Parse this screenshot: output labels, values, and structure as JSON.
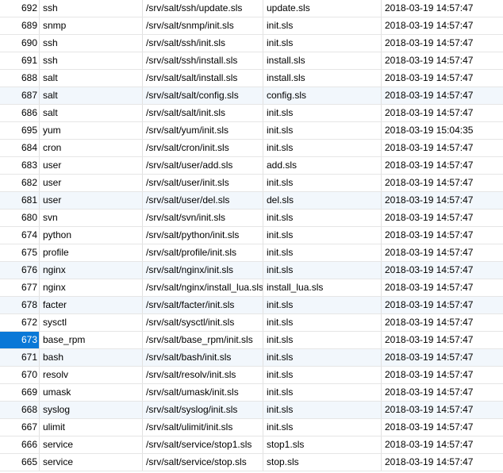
{
  "table": {
    "selected_id": "673",
    "rows": [
      {
        "id": "692",
        "name": "ssh",
        "path": "/srv/salt/ssh/update.sls",
        "file": "update.sls",
        "time": "2018-03-19 14:57:47"
      },
      {
        "id": "689",
        "name": "snmp",
        "path": "/srv/salt/snmp/init.sls",
        "file": "init.sls",
        "time": "2018-03-19 14:57:47"
      },
      {
        "id": "690",
        "name": "ssh",
        "path": "/srv/salt/ssh/init.sls",
        "file": "init.sls",
        "time": "2018-03-19 14:57:47"
      },
      {
        "id": "691",
        "name": "ssh",
        "path": "/srv/salt/ssh/install.sls",
        "file": "install.sls",
        "time": "2018-03-19 14:57:47"
      },
      {
        "id": "688",
        "name": "salt",
        "path": "/srv/salt/salt/install.sls",
        "file": "install.sls",
        "time": "2018-03-19 14:57:47"
      },
      {
        "id": "687",
        "name": "salt",
        "path": "/srv/salt/salt/config.sls",
        "file": "config.sls",
        "time": "2018-03-19 14:57:47"
      },
      {
        "id": "686",
        "name": "salt",
        "path": "/srv/salt/salt/init.sls",
        "file": "init.sls",
        "time": "2018-03-19 14:57:47"
      },
      {
        "id": "695",
        "name": "yum",
        "path": "/srv/salt/yum/init.sls",
        "file": "init.sls",
        "time": "2018-03-19 15:04:35"
      },
      {
        "id": "684",
        "name": "cron",
        "path": "/srv/salt/cron/init.sls",
        "file": "init.sls",
        "time": "2018-03-19 14:57:47"
      },
      {
        "id": "683",
        "name": "user",
        "path": "/srv/salt/user/add.sls",
        "file": "add.sls",
        "time": "2018-03-19 14:57:47"
      },
      {
        "id": "682",
        "name": "user",
        "path": "/srv/salt/user/init.sls",
        "file": "init.sls",
        "time": "2018-03-19 14:57:47"
      },
      {
        "id": "681",
        "name": "user",
        "path": "/srv/salt/user/del.sls",
        "file": "del.sls",
        "time": "2018-03-19 14:57:47"
      },
      {
        "id": "680",
        "name": "svn",
        "path": "/srv/salt/svn/init.sls",
        "file": "init.sls",
        "time": "2018-03-19 14:57:47"
      },
      {
        "id": "674",
        "name": "python",
        "path": "/srv/salt/python/init.sls",
        "file": "init.sls",
        "time": "2018-03-19 14:57:47"
      },
      {
        "id": "675",
        "name": "profile",
        "path": "/srv/salt/profile/init.sls",
        "file": "init.sls",
        "time": "2018-03-19 14:57:47"
      },
      {
        "id": "676",
        "name": "nginx",
        "path": "/srv/salt/nginx/init.sls",
        "file": "init.sls",
        "time": "2018-03-19 14:57:47"
      },
      {
        "id": "677",
        "name": "nginx",
        "path": "/srv/salt/nginx/install_lua.sls",
        "file": "install_lua.sls",
        "time": "2018-03-19 14:57:47"
      },
      {
        "id": "678",
        "name": "facter",
        "path": "/srv/salt/facter/init.sls",
        "file": "init.sls",
        "time": "2018-03-19 14:57:47"
      },
      {
        "id": "672",
        "name": "sysctl",
        "path": "/srv/salt/sysctl/init.sls",
        "file": "init.sls",
        "time": "2018-03-19 14:57:47"
      },
      {
        "id": "673",
        "name": "base_rpm",
        "path": "/srv/salt/base_rpm/init.sls",
        "file": "init.sls",
        "time": "2018-03-19 14:57:47"
      },
      {
        "id": "671",
        "name": "bash",
        "path": "/srv/salt/bash/init.sls",
        "file": "init.sls",
        "time": "2018-03-19 14:57:47"
      },
      {
        "id": "670",
        "name": "resolv",
        "path": "/srv/salt/resolv/init.sls",
        "file": "init.sls",
        "time": "2018-03-19 14:57:47"
      },
      {
        "id": "669",
        "name": "umask",
        "path": "/srv/salt/umask/init.sls",
        "file": "init.sls",
        "time": "2018-03-19 14:57:47"
      },
      {
        "id": "668",
        "name": "syslog",
        "path": "/srv/salt/syslog/init.sls",
        "file": "init.sls",
        "time": "2018-03-19 14:57:47"
      },
      {
        "id": "667",
        "name": "ulimit",
        "path": "/srv/salt/ulimit/init.sls",
        "file": "init.sls",
        "time": "2018-03-19 14:57:47"
      },
      {
        "id": "666",
        "name": "service",
        "path": "/srv/salt/service/stop1.sls",
        "file": "stop1.sls",
        "time": "2018-03-19 14:57:47"
      },
      {
        "id": "665",
        "name": "service",
        "path": "/srv/salt/service/stop.sls",
        "file": "stop.sls",
        "time": "2018-03-19 14:57:47"
      }
    ]
  }
}
